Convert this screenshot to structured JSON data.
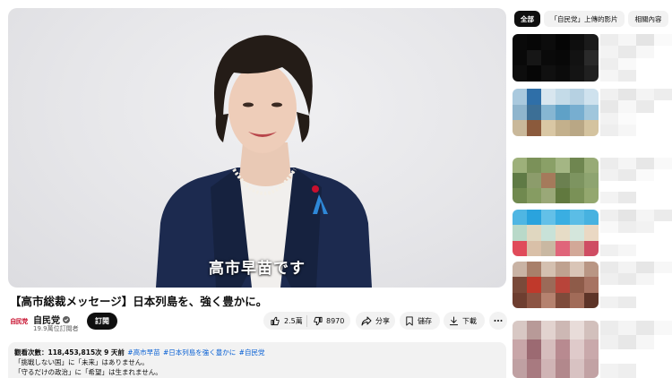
{
  "player": {
    "subtitle": "高市早苗です"
  },
  "video": {
    "title": "【高市総裁メッセージ】日本列島を、強く豊かに。"
  },
  "channel": {
    "logo_text": "自民党",
    "name": "自民党",
    "subscribers": "19.9萬位訂閱者",
    "subscribe_label": "訂閱"
  },
  "actions": {
    "likes": "2.5萬",
    "dislikes": "8970",
    "share": "分享",
    "save": "儲存",
    "download": "下載"
  },
  "description": {
    "views": "觀看次數：118,453,815次",
    "age": "9 天前",
    "hashtags": [
      "#高市早苗",
      "#日本列島を強く豊かに",
      "#自民党"
    ],
    "lines": [
      "「挑戦しない国」に「未来」はありません。",
      "「守るだけの政治」に「希望」は生まれません。"
    ]
  },
  "sidebar": {
    "chips": [
      {
        "label": "全部",
        "active": true
      },
      {
        "label": "「自民党」上傳的影片",
        "active": false
      },
      {
        "label": "相關內容",
        "active": false
      }
    ]
  },
  "colors": {
    "accent_red": "#c8102e",
    "link_blue": "#065fd4",
    "jacket_navy": "#1c2a4f",
    "background": "#ffffff",
    "pill_gray": "#f2f2f2"
  }
}
